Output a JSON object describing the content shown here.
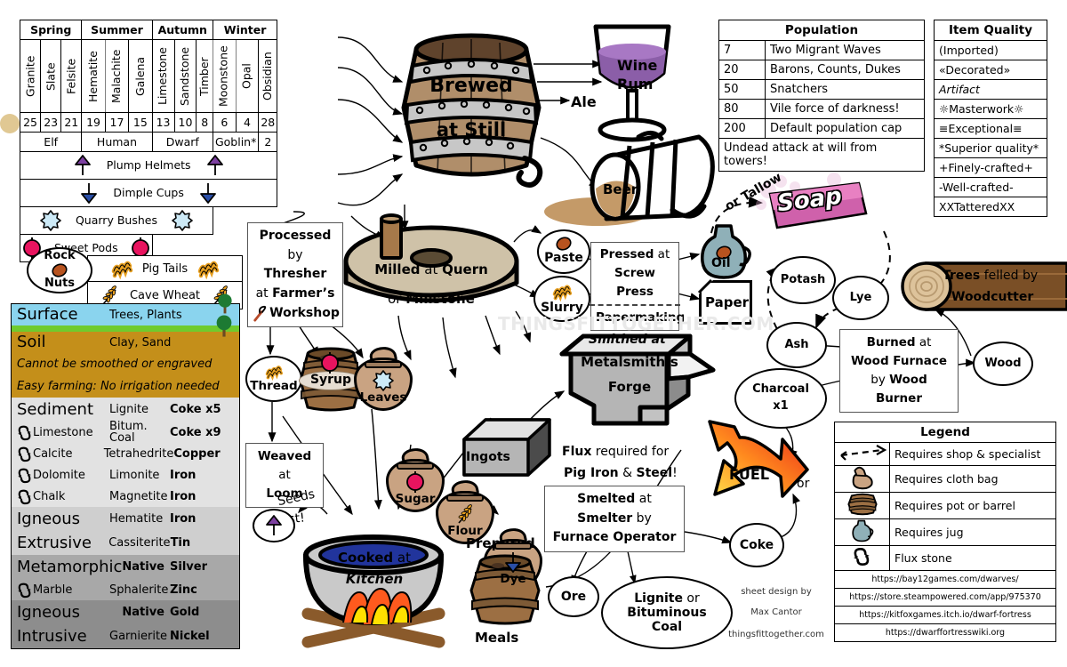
{
  "season_table": {
    "seasons": [
      "Spring",
      "Summer",
      "Autumn",
      "Winter"
    ],
    "months": [
      "Granite",
      "Slate",
      "Felsite",
      "Hematite",
      "Malachite",
      "Galena",
      "Limestone",
      "Sandstone",
      "Timber",
      "Moonstone",
      "Opal",
      "Obsidian"
    ],
    "numbers": [
      "25",
      "23",
      "21",
      "19",
      "17",
      "15",
      "13",
      "10",
      "8",
      "6",
      "4",
      "28"
    ],
    "races": [
      {
        "label": "Elf",
        "span": 3
      },
      {
        "label": "Human",
        "span": 3
      },
      {
        "label": "Dwarf",
        "span": 3
      },
      {
        "label": "Goblin*",
        "span": 2
      },
      {
        "label": "2",
        "span": 1
      }
    ],
    "crops": [
      {
        "label": "Plump Helmets",
        "icon": "plump-helmet-icon"
      },
      {
        "label": "Dimple Cups",
        "icon": "dimple-cup-icon"
      },
      {
        "label": "Quarry Bushes",
        "icon": "quarry-bush-icon"
      },
      {
        "label": "Sweet Pods",
        "icon": "sweet-pod-icon"
      }
    ],
    "crops2": [
      {
        "label": "Pig Tails",
        "icon": "pig-tail-icon"
      },
      {
        "label": "Cave Wheat",
        "icon": "cave-wheat-icon"
      }
    ]
  },
  "geology": {
    "rows": [
      {
        "a": "Surface",
        "b": "Trees, Plants",
        "c": "",
        "style": "surface"
      },
      {
        "a": "Soil",
        "b": "Clay, Sand",
        "c": "",
        "style": "soil"
      },
      {
        "a": "Cannot be smoothed or engraved",
        "b": "",
        "c": "",
        "style": "soil-note"
      },
      {
        "a": "Easy farming: No irrigation needed",
        "b": "",
        "c": "",
        "style": "soil-note"
      },
      {
        "a": "Sediment",
        "b": "Lignite",
        "c": "Coke x5",
        "style": "sed"
      },
      {
        "a": "Limestone",
        "b": "Bitum. Coal",
        "c": "Coke x9",
        "style": "sed",
        "flux": true
      },
      {
        "a": "Calcite",
        "b": "Tetrahedrite",
        "c": "Copper",
        "style": "sed",
        "flux": true
      },
      {
        "a": "Dolomite",
        "b": "Limonite",
        "c": "Iron",
        "style": "sed",
        "flux": true
      },
      {
        "a": "Chalk",
        "b": "Magnetite",
        "c": "Iron",
        "style": "sed",
        "flux": true
      },
      {
        "a": "Igneous",
        "b": "Hematite",
        "c": "Iron",
        "style": "ign1"
      },
      {
        "a": "Extrusive",
        "b": "Cassiterite",
        "c": "Tin",
        "style": "ign1"
      },
      {
        "a": "Metamorphic",
        "b": "Native",
        "c": "Silver",
        "style": "meta"
      },
      {
        "a": "Marble",
        "b": "Sphalerite",
        "c": "Zinc",
        "style": "meta",
        "flux": true
      },
      {
        "a": "Igneous",
        "b": "Native",
        "c": "Gold",
        "style": "ign2"
      },
      {
        "a": "Intrusive",
        "b": "Garnierite",
        "c": "Nickel",
        "style": "ign2"
      }
    ]
  },
  "population": {
    "title": "Population",
    "rows": [
      {
        "num": "7",
        "text": "Two Migrant Waves"
      },
      {
        "num": "20",
        "text": "Barons, Counts, Dukes"
      },
      {
        "num": "50",
        "text": "Snatchers"
      },
      {
        "num": "80",
        "text": "Vile force of darkness!"
      },
      {
        "num": "200",
        "text": "Default population cap"
      }
    ],
    "footer": "Undead attack at will from towers!"
  },
  "item_quality": {
    "title": "Item Quality",
    "rows": [
      "(Imported)",
      "«Decorated»",
      "Artifact",
      "☼Masterwork☼",
      "≡Exceptional≡",
      "*Superior quality*",
      "+Finely-crafted+",
      "-Well-crafted-",
      "XXTatteredXX"
    ]
  },
  "legend": {
    "title": "Legend",
    "rows": [
      {
        "icon": "dashed-arrow-icon",
        "text": "Requires shop & specialist"
      },
      {
        "icon": "cloth-bag-icon",
        "text": "Requires cloth bag"
      },
      {
        "icon": "barrel-icon",
        "text": "Requires pot or barrel"
      },
      {
        "icon": "jug-icon",
        "text": "Requires jug"
      },
      {
        "icon": "flux-stone-icon",
        "text": "Flux stone"
      }
    ],
    "urls": [
      "https://bay12games.com/dwarves/",
      "https://store.steampowered.com/app/975370",
      "https://kitfoxgames.itch.io/dwarf-fortress",
      "https://dwarffortresswiki.org"
    ]
  },
  "diagram": {
    "barrel": {
      "line1": "Brewed",
      "line2": "at Still"
    },
    "drinks": {
      "wine": "Wine",
      "rum": "Rum",
      "ale": "Ale",
      "beer": "Beer"
    },
    "rock_nuts": {
      "line1": "Rock",
      "line2": "Nuts"
    },
    "processed_box": {
      "l1a": "Processed",
      "l2a": "by ",
      "l2b": "Thresher",
      "l3a": "at ",
      "l3b": "Farmer’s",
      "l4b": "Workshop"
    },
    "quern": {
      "line1a": "Milled",
      "line1b": " at ",
      "line1c": "Quern",
      "line2a": "or ",
      "line2b": "Millstone"
    },
    "paste": "Paste",
    "slurry": "Slurry",
    "press_box": {
      "l1a": "Pressed",
      "l1b": " at",
      "l2": "Screw Press",
      "l3": "Papermaking"
    },
    "oil": "Oil",
    "paper": "Paper",
    "soap": "Soap",
    "tallow": "or Tallow",
    "potash": "Potash",
    "lye": "Lye",
    "ash": "Ash",
    "charcoal": {
      "line1": "Charcoal",
      "line2": "x1"
    },
    "wood": "Wood",
    "trees": {
      "l1a": "Trees",
      "l1b": " felled by",
      "l2": "Woodcutter"
    },
    "burned_box": {
      "l1a": "Burned",
      "l1b": " at",
      "l2": "Wood Furnace",
      "l3a": "by ",
      "l3b": "Wood Burner"
    },
    "products": {
      "thread": "Thread",
      "syrup": "Syrup",
      "leaves": "Leaves",
      "sugar": "Sugar",
      "flour": "Flour",
      "dye": "Dye"
    },
    "loom_box": {
      "l1a": "Weaved",
      "l1b": " at",
      "l2": "Loom"
    },
    "seeds_lost": {
      "l1": "Seeds",
      "l2": "lost!"
    },
    "kitchen": {
      "l1a": "Cooked",
      "l1b": " at",
      "l2": "Kitchen"
    },
    "prepared_meals": {
      "top": "Prepared",
      "bottom": "Meals"
    },
    "ingots": "Ingots",
    "anvil": {
      "l1": "Smithed at",
      "l2": "Metalsmith’s",
      "l3": "Forge"
    },
    "flux_note": {
      "l1a": "Flux",
      "l1b": " required for",
      "l2a": "Pig Iron",
      "l2b": " & ",
      "l2c": "Steel",
      "l2d": "!"
    },
    "smelt_box": {
      "l1a": "Smelted",
      "l1b": " at",
      "l2a": "Smelter",
      "l2b": " by",
      "l3": "Furnace Operator"
    },
    "fuel": "FUEL",
    "or_label": "or",
    "coke": "Coke",
    "ore": "Ore",
    "coal": {
      "l1a": "Lignite",
      "l1b": " or",
      "l2": "Bituminous",
      "l3": "Coal"
    },
    "watermark": "THINGSFITTOGETHER.COM"
  },
  "credits": {
    "l1": "sheet design by",
    "l2": "Max Cantor",
    "l3": "thingsfittogether.com"
  },
  "colors": {
    "barrel_wood": "#b08e6a",
    "barrel_band": "#c7c7c7",
    "wine": "#8b5ea8",
    "soap": "#e07bbd",
    "fuel_hot": "#e8221a",
    "fuel_cool": "#ffe14d",
    "sweet_pod": "#e8145f",
    "plump_helmet": "#7c3fa0",
    "dimple_cup": "#2a4fa8",
    "quarry_bush": "#cdeaf7",
    "pig_tail": "#e8a020",
    "surface_sky": "#8ad4ee",
    "soil": "#c48f1a"
  }
}
